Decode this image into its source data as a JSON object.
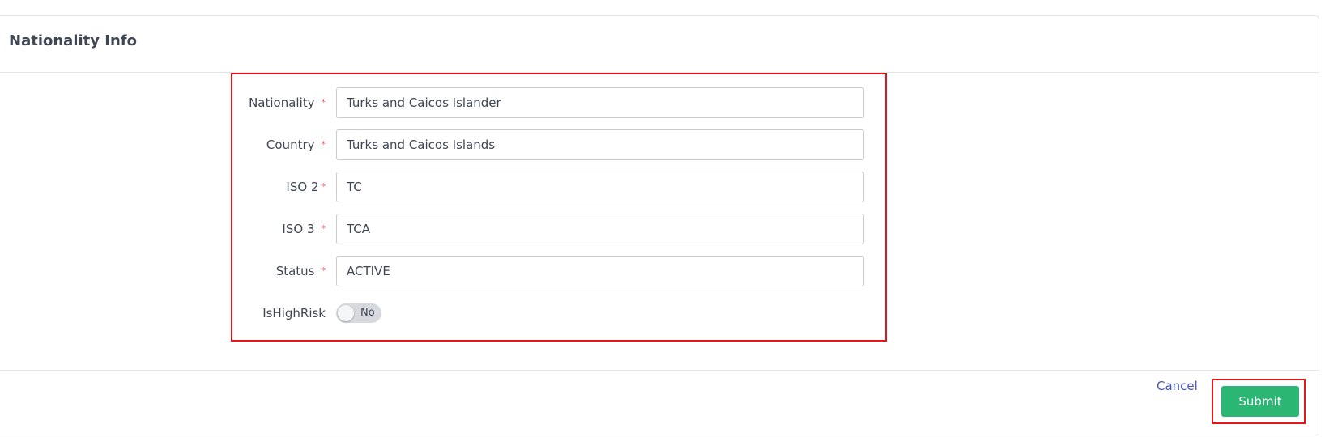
{
  "header": {
    "title": "Nationality Info"
  },
  "form": {
    "fields": [
      {
        "label": "Nationality",
        "required_mark": "*",
        "value": "Turks and Caicos Islander"
      },
      {
        "label": "Country",
        "required_mark": "*",
        "value": "Turks and Caicos Islands"
      },
      {
        "label": "ISO 2",
        "required_mark": "*",
        "value": "TC"
      },
      {
        "label": "ISO 3",
        "required_mark": "*",
        "value": "TCA"
      },
      {
        "label": "Status",
        "required_mark": "*",
        "value": "ACTIVE"
      }
    ],
    "high_risk": {
      "label": "IsHighRisk",
      "toggle_text": "No",
      "checked": false
    }
  },
  "footer": {
    "cancel_label": "Cancel",
    "submit_label": "Submit"
  },
  "colors": {
    "primary_button": "#2bb673",
    "link": "#4a55b5",
    "required": "#f0535b",
    "highlight_border": "#e3161b"
  }
}
